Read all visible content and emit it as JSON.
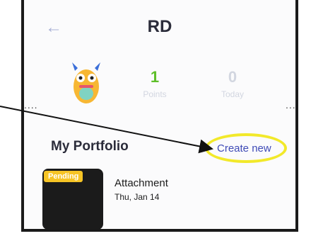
{
  "header": {
    "title": "RD"
  },
  "stats": [
    {
      "value": "1",
      "label": "Points",
      "color": "#5fbf2a"
    },
    {
      "value": "0",
      "label": "Today",
      "color": "#d2d6e0"
    }
  ],
  "portfolio": {
    "title": "My Portfolio",
    "create_label": "Create new"
  },
  "attachment": {
    "badge": "Pending",
    "title": "Attachment",
    "date": "Thu, Jan 14"
  },
  "dots": "....",
  "icons": [
    "back-arrow-icon",
    "monster-avatar-icon"
  ],
  "colors": {
    "accent": "#3f4bb6",
    "highlight": "#f2e92a",
    "pending": "#f6c425"
  }
}
